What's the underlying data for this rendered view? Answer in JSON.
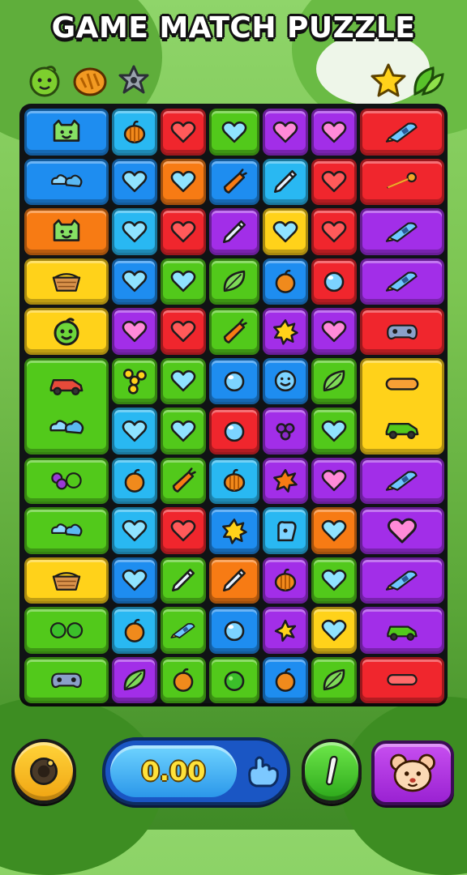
{
  "title": "GAME MATCH PUZZLE",
  "top_icons_left": [
    "lime-icon",
    "orange-bun-icon",
    "flower-icon"
  ],
  "top_icons_right": [
    "star-icon",
    "leaves-icon"
  ],
  "score": "0.00",
  "colors": {
    "blue": "#1e8df0",
    "cyan": "#29b8f2",
    "red": "#f0262d",
    "orange": "#f77b14",
    "green": "#52c91b",
    "darkgreen": "#2aa81c",
    "yellow": "#ffd21a",
    "purple": "#a22ee8",
    "magenta": "#c038e8"
  },
  "board": {
    "rows": [
      [
        {
          "c": "blue",
          "i": "cat-face-icon"
        },
        {
          "c": "cyan",
          "i": "pumpkin-icon"
        },
        {
          "c": "red",
          "i": "heart-icon"
        },
        {
          "c": "green",
          "i": "heart-icon"
        },
        {
          "c": "purple",
          "i": "heart-icon"
        },
        {
          "c": "purple",
          "i": "heart-icon"
        },
        {
          "c": "red",
          "i": "crayon-icon"
        }
      ],
      [
        {
          "c": "blue",
          "i": "cloud-pair-icon"
        },
        {
          "c": "blue",
          "i": "heart-icon"
        },
        {
          "c": "orange",
          "i": "heart-icon"
        },
        {
          "c": "blue",
          "i": "carrot-icon"
        },
        {
          "c": "cyan",
          "i": "pencil-icon"
        },
        {
          "c": "red",
          "i": "heart-icon"
        },
        {
          "c": "red",
          "i": "key-icon"
        }
      ],
      [
        {
          "c": "orange",
          "i": "cat-face-icon"
        },
        {
          "c": "cyan",
          "i": "heart-icon"
        },
        {
          "c": "red",
          "i": "heart-icon"
        },
        {
          "c": "purple",
          "i": "pencil-icon"
        },
        {
          "c": "yellow",
          "i": "heart-icon"
        },
        {
          "c": "red",
          "i": "heart-icon"
        },
        {
          "c": "purple",
          "i": "crayon-icon"
        }
      ],
      [
        {
          "c": "yellow",
          "i": "basket-icon"
        },
        {
          "c": "blue",
          "i": "heart-icon"
        },
        {
          "c": "green",
          "i": "heart-icon"
        },
        {
          "c": "green",
          "i": "leaf-icon"
        },
        {
          "c": "blue",
          "i": "apple-icon"
        },
        {
          "c": "red",
          "i": "orb-icon"
        },
        {
          "c": "purple",
          "i": "crayon-icon"
        }
      ],
      [
        {
          "c": "yellow",
          "i": "lime-face-icon"
        },
        {
          "c": "purple",
          "i": "heart-icon"
        },
        {
          "c": "red",
          "i": "heart-icon"
        },
        {
          "c": "green",
          "i": "carrot-icon"
        },
        {
          "c": "purple",
          "i": "sun-icon"
        },
        {
          "c": "purple",
          "i": "heart-icon"
        },
        {
          "c": "red",
          "i": "gamepad-icon"
        }
      ],
      [
        null,
        {
          "c": "green",
          "i": "fidget-icon"
        },
        {
          "c": "green",
          "i": "heart-icon"
        },
        {
          "c": "blue",
          "i": "orb-icon"
        },
        {
          "c": "blue",
          "i": "smiley-icon"
        },
        {
          "c": "green",
          "i": "leaf-icon"
        },
        null
      ],
      [
        null,
        {
          "c": "cyan",
          "i": "heart-icon"
        },
        {
          "c": "green",
          "i": "heart-icon"
        },
        {
          "c": "red",
          "i": "orb-icon"
        },
        {
          "c": "purple",
          "i": "grapes-icon"
        },
        {
          "c": "green",
          "i": "heart-icon"
        },
        null
      ],
      [
        {
          "c": "green",
          "i": "grape-cluster-icon"
        },
        {
          "c": "cyan",
          "i": "apple-icon"
        },
        {
          "c": "green",
          "i": "carrot-icon"
        },
        {
          "c": "cyan",
          "i": "pumpkin-icon"
        },
        {
          "c": "purple",
          "i": "splat-icon"
        },
        {
          "c": "purple",
          "i": "heart-icon"
        },
        {
          "c": "purple",
          "i": "crayon-icon"
        }
      ],
      [
        {
          "c": "green",
          "i": "cloud-pair-icon"
        },
        {
          "c": "cyan",
          "i": "heart-icon"
        },
        {
          "c": "red",
          "i": "heart-icon"
        },
        {
          "c": "blue",
          "i": "sun-icon"
        },
        {
          "c": "cyan",
          "i": "glove-icon"
        },
        {
          "c": "orange",
          "i": "heart-icon"
        },
        {
          "c": "purple",
          "i": "heart-icon"
        }
      ],
      [
        {
          "c": "yellow",
          "i": "basket-icon"
        },
        {
          "c": "blue",
          "i": "heart-icon"
        },
        {
          "c": "green",
          "i": "pencil-icon"
        },
        {
          "c": "orange",
          "i": "pencil-icon"
        },
        {
          "c": "purple",
          "i": "pumpkin-icon"
        },
        {
          "c": "green",
          "i": "heart-icon"
        },
        {
          "c": "purple",
          "i": "crayon-icon"
        }
      ],
      [
        {
          "c": "green",
          "i": "bush-pair-icon"
        },
        {
          "c": "cyan",
          "i": "apple-icon"
        },
        {
          "c": "green",
          "i": "crayon-icon"
        },
        {
          "c": "blue",
          "i": "orb-icon"
        },
        {
          "c": "purple",
          "i": "flower-icon"
        },
        {
          "c": "yellow",
          "i": "heart-icon"
        },
        {
          "c": "purple",
          "i": "car-icon"
        }
      ],
      [
        {
          "c": "green",
          "i": "gamepad-icon"
        },
        {
          "c": "purple",
          "i": "leaf-icon"
        },
        {
          "c": "green",
          "i": "apple-icon"
        },
        {
          "c": "green",
          "i": "bush-icon"
        },
        {
          "c": "blue",
          "i": "apple-icon"
        },
        {
          "c": "green",
          "i": "leaf-icon"
        },
        {
          "c": "red",
          "i": "bar-icon"
        }
      ]
    ],
    "big_tiles": [
      {
        "c": "green",
        "i": "cars-and-plane-icon",
        "side": "left"
      },
      {
        "c": "yellow",
        "i": "ruler-and-truck-icon",
        "side": "right"
      }
    ]
  },
  "controls": {
    "left_button": "speaker-icon",
    "plus_icon": "hand-icon",
    "middle_button": "pencil-icon",
    "right_button": "bear-face-icon"
  }
}
